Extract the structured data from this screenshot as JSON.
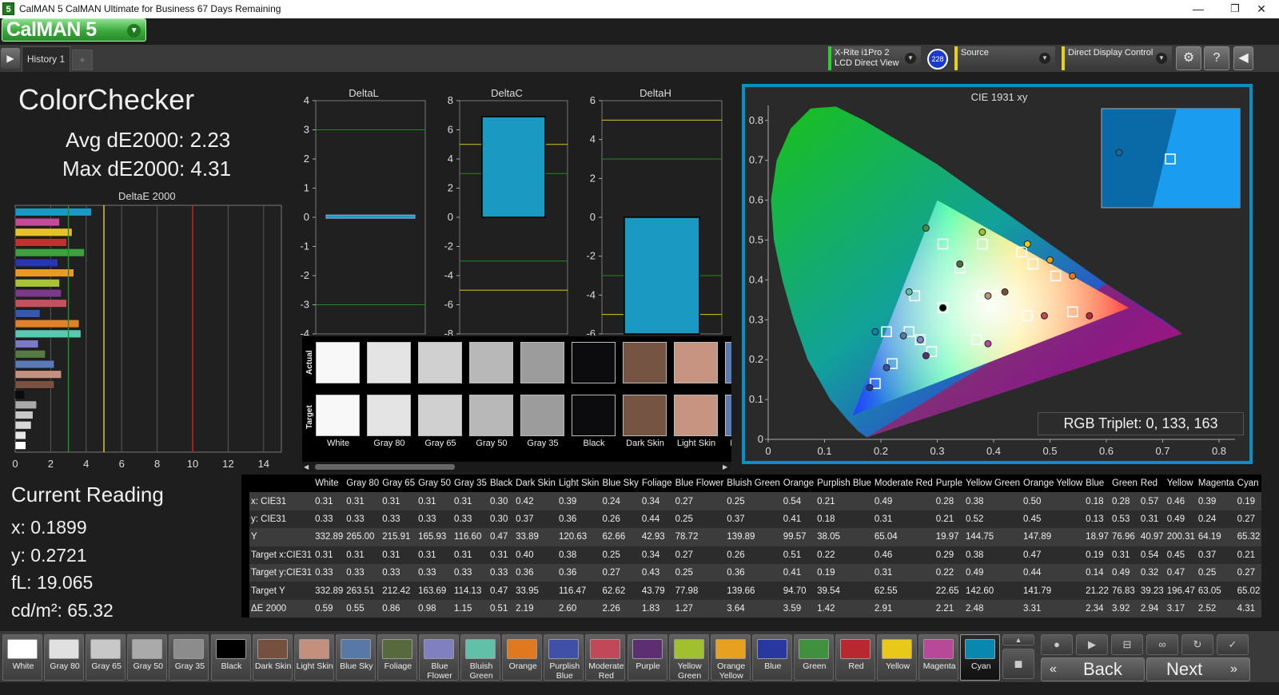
{
  "window": {
    "title": "CalMAN 5 CalMAN Ultimate for Business 67 Days Remaining",
    "app_icon": "5",
    "minimize": "—",
    "maximize": "❐",
    "close": "✕"
  },
  "logo": {
    "text": "CalMAN 5",
    "dropdown_icon": "chevron-down-icon"
  },
  "history": {
    "tab": "History 1",
    "add": "+"
  },
  "devices": {
    "meter": {
      "line1": "X-Rite i1Pro 2",
      "line2": "LCD Direct View",
      "badge": "228"
    },
    "source": {
      "label": "Source"
    },
    "display": {
      "label": "Direct Display Control"
    }
  },
  "summary": {
    "title": "ColorChecker",
    "avg": "Avg dE2000: 2.23",
    "max": "Max dE2000: 4.31"
  },
  "current_reading": {
    "title": "Current Reading",
    "x": "x: 0.1899",
    "y": "y: 0.2721",
    "fl": "fL: 19.065",
    "cdm2": "cd/m²: 65.32"
  },
  "charts": {
    "deltae": {
      "title": "DeltaE 2000",
      "xticks": [
        "0",
        "2",
        "4",
        "6",
        "8",
        "10",
        "12",
        "14"
      ],
      "values": [
        4.3,
        2.5,
        3.2,
        2.9,
        3.9,
        2.4,
        3.3,
        2.5,
        2.6,
        2.9,
        1.4,
        3.6,
        3.7,
        1.3,
        1.7,
        2.2,
        2.6,
        2.2,
        0.5,
        1.2,
        1.0,
        0.9,
        0.6,
        0.6
      ],
      "colors": [
        "#1a9ac2",
        "#c44a9a",
        "#e8c22a",
        "#c43030",
        "#3fa040",
        "#2a35b0",
        "#e89a25",
        "#a8c23a",
        "#7a3a8a",
        "#c45060",
        "#3a55b0",
        "#e0822a",
        "#5ac8b0",
        "#7a7ac8",
        "#557a45",
        "#5a7ab8",
        "#c49080",
        "#7a5040",
        "#0a0a0a",
        "#aaaaaa",
        "#c8c8c8",
        "#d8d8d8",
        "#e8e8e8",
        "#ffffff"
      ],
      "thresholds": [
        {
          "value": 3,
          "color": "#2a8a2a"
        },
        {
          "value": 5,
          "color": "#d8c820"
        },
        {
          "value": 10,
          "color": "#c82020"
        }
      ]
    },
    "deltaL": {
      "title": "DeltaL",
      "yticks": [
        "4",
        "3",
        "2",
        "1",
        "0",
        "-1",
        "-2",
        "-3",
        "-4"
      ],
      "ylim": [
        -4,
        4
      ],
      "value": 0.05
    },
    "deltaC": {
      "title": "DeltaC",
      "yticks": [
        "8",
        "6",
        "4",
        "2",
        "0",
        "-2",
        "-4",
        "-6",
        "-8"
      ],
      "ylim": [
        -8,
        8
      ],
      "value": 6.9
    },
    "deltaH": {
      "title": "DeltaH",
      "yticks": [
        "6",
        "4",
        "2",
        "0",
        "-2",
        "-4",
        "-6"
      ],
      "ylim": [
        -6,
        6
      ],
      "value": -6
    },
    "cie": {
      "title": "CIE 1931 xy",
      "xticks": [
        "0",
        "0.1",
        "0.2",
        "0.3",
        "0.4",
        "0.5",
        "0.6",
        "0.7",
        "0.8"
      ],
      "yticks": [
        "0",
        "0.1",
        "0.2",
        "0.3",
        "0.4",
        "0.5",
        "0.6",
        "0.7",
        "0.8"
      ],
      "rgb_triplet": "RGB Triplet: 0, 133, 163"
    }
  },
  "chart_data": [
    {
      "type": "bar",
      "title": "DeltaE 2000",
      "orientation": "horizontal",
      "xlim": [
        0,
        15
      ],
      "values": [
        4.3,
        2.5,
        3.2,
        2.9,
        3.9,
        2.4,
        3.3,
        2.5,
        2.6,
        2.9,
        1.4,
        3.6,
        3.7,
        1.3,
        1.7,
        2.2,
        2.6,
        2.2,
        0.5,
        1.2,
        1.0,
        0.9,
        0.6,
        0.6
      ]
    },
    {
      "type": "scatter",
      "title": "CIE 1931 xy",
      "xlim": [
        0,
        0.8
      ],
      "ylim": [
        0,
        0.8
      ],
      "target": [
        [
          0.31,
          0.33
        ],
        [
          0.4,
          0.36
        ],
        [
          0.38,
          0.36
        ],
        [
          0.25,
          0.27
        ],
        [
          0.34,
          0.43
        ],
        [
          0.27,
          0.25
        ],
        [
          0.26,
          0.36
        ],
        [
          0.51,
          0.41
        ],
        [
          0.22,
          0.19
        ],
        [
          0.46,
          0.31
        ],
        [
          0.29,
          0.22
        ],
        [
          0.38,
          0.49
        ],
        [
          0.47,
          0.44
        ],
        [
          0.19,
          0.14
        ],
        [
          0.31,
          0.49
        ],
        [
          0.54,
          0.32
        ],
        [
          0.45,
          0.47
        ],
        [
          0.37,
          0.25
        ],
        [
          0.21,
          0.27
        ]
      ],
      "actual": [
        [
          0.31,
          0.33
        ],
        [
          0.42,
          0.37
        ],
        [
          0.39,
          0.36
        ],
        [
          0.24,
          0.26
        ],
        [
          0.34,
          0.44
        ],
        [
          0.27,
          0.25
        ],
        [
          0.25,
          0.37
        ],
        [
          0.54,
          0.41
        ],
        [
          0.21,
          0.18
        ],
        [
          0.49,
          0.31
        ],
        [
          0.28,
          0.21
        ],
        [
          0.38,
          0.52
        ],
        [
          0.5,
          0.45
        ],
        [
          0.18,
          0.13
        ],
        [
          0.28,
          0.53
        ],
        [
          0.57,
          0.31
        ],
        [
          0.46,
          0.49
        ],
        [
          0.39,
          0.24
        ],
        [
          0.19,
          0.27
        ]
      ]
    }
  ],
  "swatches": {
    "actual_label": "Actual",
    "target_label": "Target",
    "items": [
      {
        "name": "White",
        "color": "#f8f8f8"
      },
      {
        "name": "Gray 80",
        "color": "#e4e4e4"
      },
      {
        "name": "Gray 65",
        "color": "#d0d0d0"
      },
      {
        "name": "Gray 50",
        "color": "#b8b8b8"
      },
      {
        "name": "Gray 35",
        "color": "#9c9c9c"
      },
      {
        "name": "Black",
        "color": "#0c0c0e"
      },
      {
        "name": "Dark Skin",
        "color": "#765443"
      },
      {
        "name": "Light Skin",
        "color": "#c79482"
      },
      {
        "name": "Blue Sky",
        "color": "#5a7ab0"
      }
    ]
  },
  "table": {
    "columns": [
      "White",
      "Gray 80",
      "Gray 65",
      "Gray 50",
      "Gray 35",
      "Black",
      "Dark Skin",
      "Light Skin",
      "Blue Sky",
      "Foliage",
      "Blue Flower",
      "Bluish Green",
      "Orange",
      "Purplish Blue",
      "Moderate Red",
      "Purple",
      "Yellow Green",
      "Orange Yellow",
      "Blue",
      "Green",
      "Red",
      "Yellow",
      "Magenta",
      "Cyan"
    ],
    "rows": [
      {
        "label": "x: CIE31",
        "values": [
          "0.31",
          "0.31",
          "0.31",
          "0.31",
          "0.31",
          "0.30",
          "0.42",
          "0.39",
          "0.24",
          "0.34",
          "0.27",
          "0.25",
          "0.54",
          "0.21",
          "0.49",
          "0.28",
          "0.38",
          "0.50",
          "0.18",
          "0.28",
          "0.57",
          "0.46",
          "0.39",
          "0.19"
        ]
      },
      {
        "label": "y: CIE31",
        "values": [
          "0.33",
          "0.33",
          "0.33",
          "0.33",
          "0.33",
          "0.30",
          "0.37",
          "0.36",
          "0.26",
          "0.44",
          "0.25",
          "0.37",
          "0.41",
          "0.18",
          "0.31",
          "0.21",
          "0.52",
          "0.45",
          "0.13",
          "0.53",
          "0.31",
          "0.49",
          "0.24",
          "0.27"
        ]
      },
      {
        "label": "Y",
        "values": [
          "332.89",
          "265.00",
          "215.91",
          "165.93",
          "116.60",
          "0.47",
          "33.89",
          "120.63",
          "62.66",
          "42.93",
          "78.72",
          "139.89",
          "99.57",
          "38.05",
          "65.04",
          "19.97",
          "144.75",
          "147.89",
          "18.97",
          "76.96",
          "40.97",
          "200.31",
          "64.19",
          "65.32"
        ]
      },
      {
        "label": "Target x:CIE31",
        "values": [
          "0.31",
          "0.31",
          "0.31",
          "0.31",
          "0.31",
          "0.31",
          "0.40",
          "0.38",
          "0.25",
          "0.34",
          "0.27",
          "0.26",
          "0.51",
          "0.22",
          "0.46",
          "0.29",
          "0.38",
          "0.47",
          "0.19",
          "0.31",
          "0.54",
          "0.45",
          "0.37",
          "0.21"
        ]
      },
      {
        "label": "Target y:CIE31",
        "values": [
          "0.33",
          "0.33",
          "0.33",
          "0.33",
          "0.33",
          "0.33",
          "0.36",
          "0.36",
          "0.27",
          "0.43",
          "0.25",
          "0.36",
          "0.41",
          "0.19",
          "0.31",
          "0.22",
          "0.49",
          "0.44",
          "0.14",
          "0.49",
          "0.32",
          "0.47",
          "0.25",
          "0.27"
        ]
      },
      {
        "label": "Target Y",
        "values": [
          "332.89",
          "263.51",
          "212.42",
          "163.69",
          "114.13",
          "0.47",
          "33.95",
          "116.47",
          "62.62",
          "43.79",
          "77.98",
          "139.66",
          "94.70",
          "39.54",
          "62.55",
          "22.65",
          "142.60",
          "141.79",
          "21.22",
          "76.83",
          "39.23",
          "196.47",
          "63.05",
          "65.02"
        ]
      },
      {
        "label": "ΔE 2000",
        "values": [
          "0.59",
          "0.55",
          "0.86",
          "0.98",
          "1.15",
          "0.51",
          "2.19",
          "2.60",
          "2.26",
          "1.83",
          "1.27",
          "3.64",
          "3.59",
          "1.42",
          "2.91",
          "2.21",
          "2.48",
          "3.31",
          "2.34",
          "3.92",
          "2.94",
          "3.17",
          "2.52",
          "4.31"
        ]
      }
    ]
  },
  "patches": [
    {
      "label": "White",
      "color": "#ffffff"
    },
    {
      "label": "Gray 80",
      "color": "#e0e0e0"
    },
    {
      "label": "Gray 65",
      "color": "#c8c8c8"
    },
    {
      "label": "Gray 50",
      "color": "#aaaaaa"
    },
    {
      "label": "Gray 35",
      "color": "#8c8c8c"
    },
    {
      "label": "Black",
      "color": "#000000"
    },
    {
      "label": "Dark Skin",
      "color": "#76503f"
    },
    {
      "label": "Light Skin",
      "color": "#c4907e"
    },
    {
      "label": "Blue Sky",
      "color": "#5878a8"
    },
    {
      "label": "Foliage",
      "color": "#566a3e"
    },
    {
      "label": "Blue Flower",
      "color": "#8080c0"
    },
    {
      "label": "Bluish Green",
      "color": "#60c0a8"
    },
    {
      "label": "Orange",
      "color": "#e07820"
    },
    {
      "label": "Purplish Blue",
      "color": "#4050a8"
    },
    {
      "label": "Moderate Red",
      "color": "#c04858"
    },
    {
      "label": "Purple",
      "color": "#5c3070"
    },
    {
      "label": "Yellow Green",
      "color": "#a0c030"
    },
    {
      "label": "Orange Yellow",
      "color": "#e8a020"
    },
    {
      "label": "Blue",
      "color": "#2838a0"
    },
    {
      "label": "Green",
      "color": "#409040"
    },
    {
      "label": "Red",
      "color": "#b82830"
    },
    {
      "label": "Yellow",
      "color": "#e8c818"
    },
    {
      "label": "Magenta",
      "color": "#b84898"
    },
    {
      "label": "Cyan",
      "color": "#0888b0"
    }
  ],
  "nav": {
    "back": "Back",
    "next": "Next"
  }
}
